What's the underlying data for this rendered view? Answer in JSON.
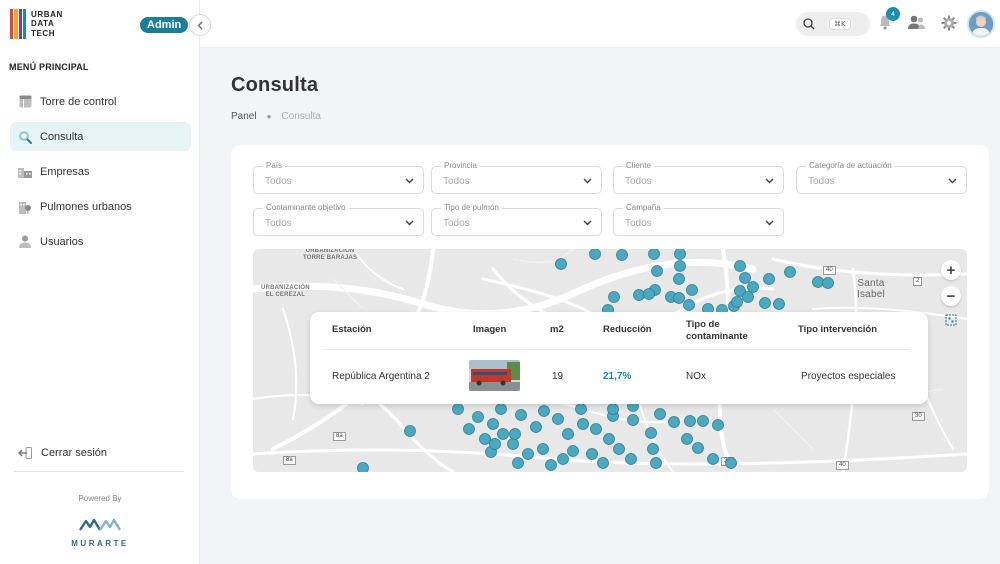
{
  "brand": {
    "line1": "URBAN",
    "line2": "DATA",
    "line3": "TECH",
    "colors": [
      "#e8443a",
      "#f5a623",
      "#7b3fa0",
      "#1a8aa6"
    ]
  },
  "admin_badge": "Admin",
  "sidebar": {
    "menu_title": "MENÚ PRINCIPAL",
    "items": [
      {
        "label": "Torre de control",
        "icon": "table-icon"
      },
      {
        "label": "Consulta",
        "icon": "search-icon"
      },
      {
        "label": "Empresas",
        "icon": "building-icon"
      },
      {
        "label": "Pulmones urbanos",
        "icon": "tree-icon"
      },
      {
        "label": "Usuarios",
        "icon": "user-icon"
      }
    ],
    "logout": "Cerrar sesión",
    "powered_by": "Powered By",
    "partner": "MURARTE"
  },
  "topbar": {
    "search_shortcut": "⌘K",
    "notification_count": "4"
  },
  "page": {
    "title": "Consulta",
    "breadcrumb": [
      "Panel",
      "Consulta"
    ]
  },
  "filters": [
    {
      "label": "País",
      "value": "Todos"
    },
    {
      "label": "Provincia",
      "value": "Todos"
    },
    {
      "label": "Cliente",
      "value": "Todos"
    },
    {
      "label": "Categoría de actuación",
      "value": "Todos"
    },
    {
      "label": "Contaminante objetivo",
      "value": "Todos"
    },
    {
      "label": "Tipo de pulmón",
      "value": "Todos"
    },
    {
      "label": "Campaña",
      "value": "Todos"
    }
  ],
  "map": {
    "labels": [
      {
        "text": "URBANIZACIÓN\nTORRE BARAJAS"
      },
      {
        "text": "URBANIZACIÓN\nEL CEREZAL"
      },
      {
        "text": "Santa\nIsabel"
      }
    ],
    "roads": [
      "40",
      "2",
      "30",
      "40",
      "30",
      "8a",
      "8a"
    ],
    "zoom_in": "+",
    "zoom_out": "−",
    "marker_color": "#4aa9c0"
  },
  "popup": {
    "headers": [
      "Estación",
      "Imagen",
      "m2",
      "Reducción",
      "Tipo de\ncontaminante",
      "Tipo intervención"
    ],
    "row": {
      "station": "República Argentina 2",
      "m2": "19",
      "reduction": "21,7%",
      "pollutant": "NOx",
      "intervention": "Proyectos especiales"
    }
  }
}
